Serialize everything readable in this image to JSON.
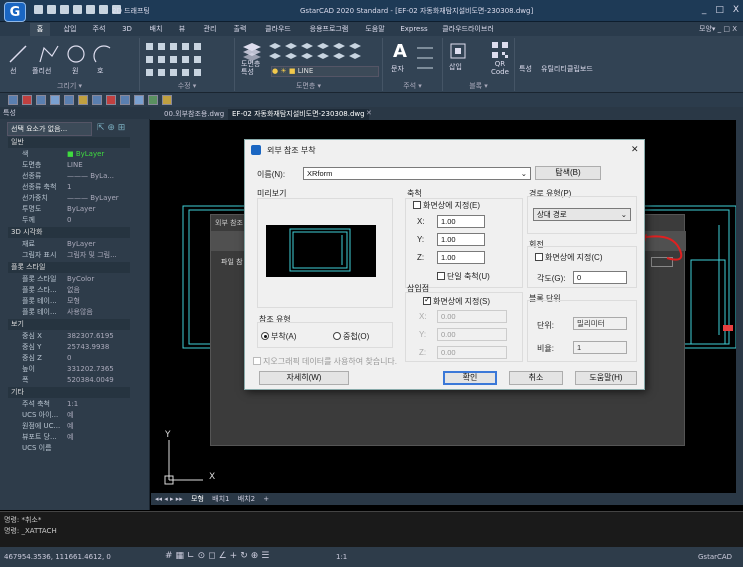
{
  "app": {
    "title": "GstarCAD 2020 Standard - [EF-02 자동화재탐지설비도면-230308.dwg]",
    "logo": "G",
    "workspace": "2D 드래프팅",
    "right_links": "모양▾ _ □ X",
    "win": {
      "min": "_",
      "max": "□",
      "close": "X"
    }
  },
  "ribbon_tabs": [
    "홈",
    "삽입",
    "주석",
    "3D",
    "배치",
    "뷰",
    "관리",
    "출력",
    "클라우드",
    "응용프로그램",
    "도움말",
    "Express",
    "클라우드라이브러리"
  ],
  "ribbon": {
    "draw": {
      "label": "그리기 ▾",
      "items": [
        "선",
        "폴리선",
        "원",
        "호"
      ]
    },
    "modify": {
      "label": "수정 ▾"
    },
    "layers": {
      "label": "도면층 ▾",
      "items": [
        "도면층\n특성"
      ],
      "layer_value": "LINE"
    },
    "annotation": {
      "label": "주석 ▾",
      "items": [
        "문자",
        "치수"
      ]
    },
    "block": {
      "label": "블록 ▾",
      "items": [
        "삽입",
        "QR\nCode"
      ]
    },
    "extra": [
      "특성",
      "유틸리티",
      "클립보드"
    ]
  },
  "left_panel": {
    "title": "특성",
    "selection": "선택 요소가 없음...",
    "sections": [
      {
        "name": "일반",
        "rows": [
          [
            "색",
            "■ ByLayer"
          ],
          [
            "도면층",
            "LINE"
          ],
          [
            "선종류",
            "——— ByLa..."
          ],
          [
            "선종류 축척",
            "1"
          ],
          [
            "선가중치",
            "——— ByLayer"
          ],
          [
            "투명도",
            "ByLayer"
          ],
          [
            "두께",
            "0"
          ]
        ]
      },
      {
        "name": "3D 시각화",
        "rows": [
          [
            "재료",
            "ByLayer"
          ],
          [
            "그림자 표시",
            "그림자 및 그림..."
          ]
        ]
      },
      {
        "name": "플롯 스타일",
        "rows": [
          [
            "플롯 스타일",
            "ByColor"
          ],
          [
            "플롯 스타...",
            "없음"
          ],
          [
            "플롯 테이...",
            "모형"
          ],
          [
            "플롯 테이...",
            "사용않음"
          ]
        ]
      },
      {
        "name": "보기",
        "rows": [
          [
            "중심 X",
            "382307.6195"
          ],
          [
            "중심 Y",
            "25743.9938"
          ],
          [
            "중심 Z",
            "0"
          ],
          [
            "높이",
            "331202.7365"
          ],
          [
            "폭",
            "520384.0049"
          ]
        ]
      },
      {
        "name": "기타",
        "rows": [
          [
            "주석 축척",
            "1:1"
          ],
          [
            "UCS 아이...",
            "예"
          ],
          [
            "원점에 UC...",
            "예"
          ],
          [
            "뷰포트 당...",
            "예"
          ],
          [
            "UCS 이름",
            ""
          ]
        ]
      }
    ]
  },
  "doc_tabs": [
    "00.외부참조용.dwg",
    "EF-02 자동화재탐지설비도면-230308.dwg"
  ],
  "bg_dialog": {
    "title": "외부 참조",
    "label": "파일 참"
  },
  "axis": {
    "y": "Y",
    "x": "X"
  },
  "model_tabs": [
    "모형",
    "배치1",
    "배치2",
    "+"
  ],
  "command": {
    "line1": "명령: *취소*",
    "line2": "명령: _XATTACH"
  },
  "status": {
    "coords": "467954.3536, 111661.4612, 0",
    "scale": "1:1",
    "app": "GstarCAD"
  },
  "dialog": {
    "title": "외부 참조 부착",
    "close": "✕",
    "name_label": "이름(N):",
    "name_value": "XRform",
    "browse": "탐색(B)",
    "preview_label": "미리보기",
    "scale": {
      "label": "축척",
      "onscreen": "화면상에 지정(E)",
      "x_label": "X:",
      "x": "1.00",
      "y_label": "Y:",
      "y": "1.00",
      "z_label": "Z:",
      "z": "1.00",
      "uniform": "단일 축척(U)"
    },
    "path": {
      "label": "경로 유형(P)",
      "value": "상대 경로"
    },
    "rotation": {
      "label": "회전",
      "onscreen": "화면상에 지정(C)",
      "angle_label": "각도(G):",
      "angle": "0"
    },
    "insert": {
      "label": "삽입점",
      "onscreen": "화면상에 지정(S)",
      "x_label": "X:",
      "x": "0.00",
      "y_label": "Y:",
      "y": "0.00",
      "z_label": "Z:",
      "z": "0.00"
    },
    "block_unit": {
      "label": "블록 단위",
      "unit_label": "단위:",
      "unit": "밀리미터",
      "factor_label": "비율:",
      "factor": "1"
    },
    "ref_type": {
      "label": "참조 유형",
      "attach": "부착(A)",
      "overlay": "중첩(O)"
    },
    "geo": "지오그래픽 데이터를 사용하여 찾습니다.",
    "details": "자세히(W)",
    "ok": "확인",
    "cancel": "취소",
    "help": "도움말(H)"
  }
}
